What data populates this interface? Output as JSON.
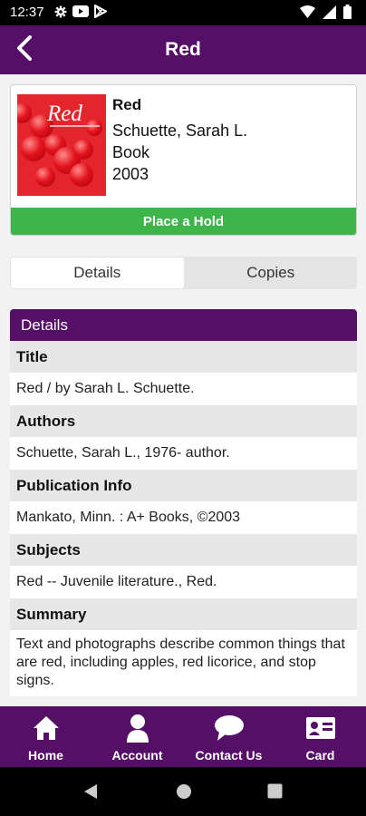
{
  "status_bar": {
    "time": "12:37"
  },
  "app_bar": {
    "title": "Red"
  },
  "book": {
    "cover_title": "Red",
    "title": "Red",
    "author": "Schuette, Sarah L.",
    "format": "Book",
    "year": "2003",
    "hold_label": "Place a Hold"
  },
  "tabs": [
    {
      "label": "Details",
      "active": true
    },
    {
      "label": "Copies",
      "active": false
    }
  ],
  "details": {
    "header": "Details",
    "fields": [
      {
        "label": "Title",
        "value": "Red / by Sarah L. Schuette."
      },
      {
        "label": "Authors",
        "value": "Schuette, Sarah L., 1976- author."
      },
      {
        "label": "Publication Info",
        "value": "Mankato, Minn. : A+ Books, ©2003"
      },
      {
        "label": "Subjects",
        "value": "Red -- Juvenile literature., Red."
      },
      {
        "label": "Summary",
        "value": "Text and photographs describe common things that are red, including apples, red licorice, and stop signs."
      }
    ]
  },
  "bottom_nav": [
    {
      "label": "Home",
      "icon": "home-icon"
    },
    {
      "label": "Account",
      "icon": "account-icon"
    },
    {
      "label": "Contact Us",
      "icon": "chat-icon"
    },
    {
      "label": "Card",
      "icon": "card-icon"
    }
  ],
  "colors": {
    "primary": "#560f66",
    "hold": "#3db54a",
    "cover": "#e3262d"
  }
}
